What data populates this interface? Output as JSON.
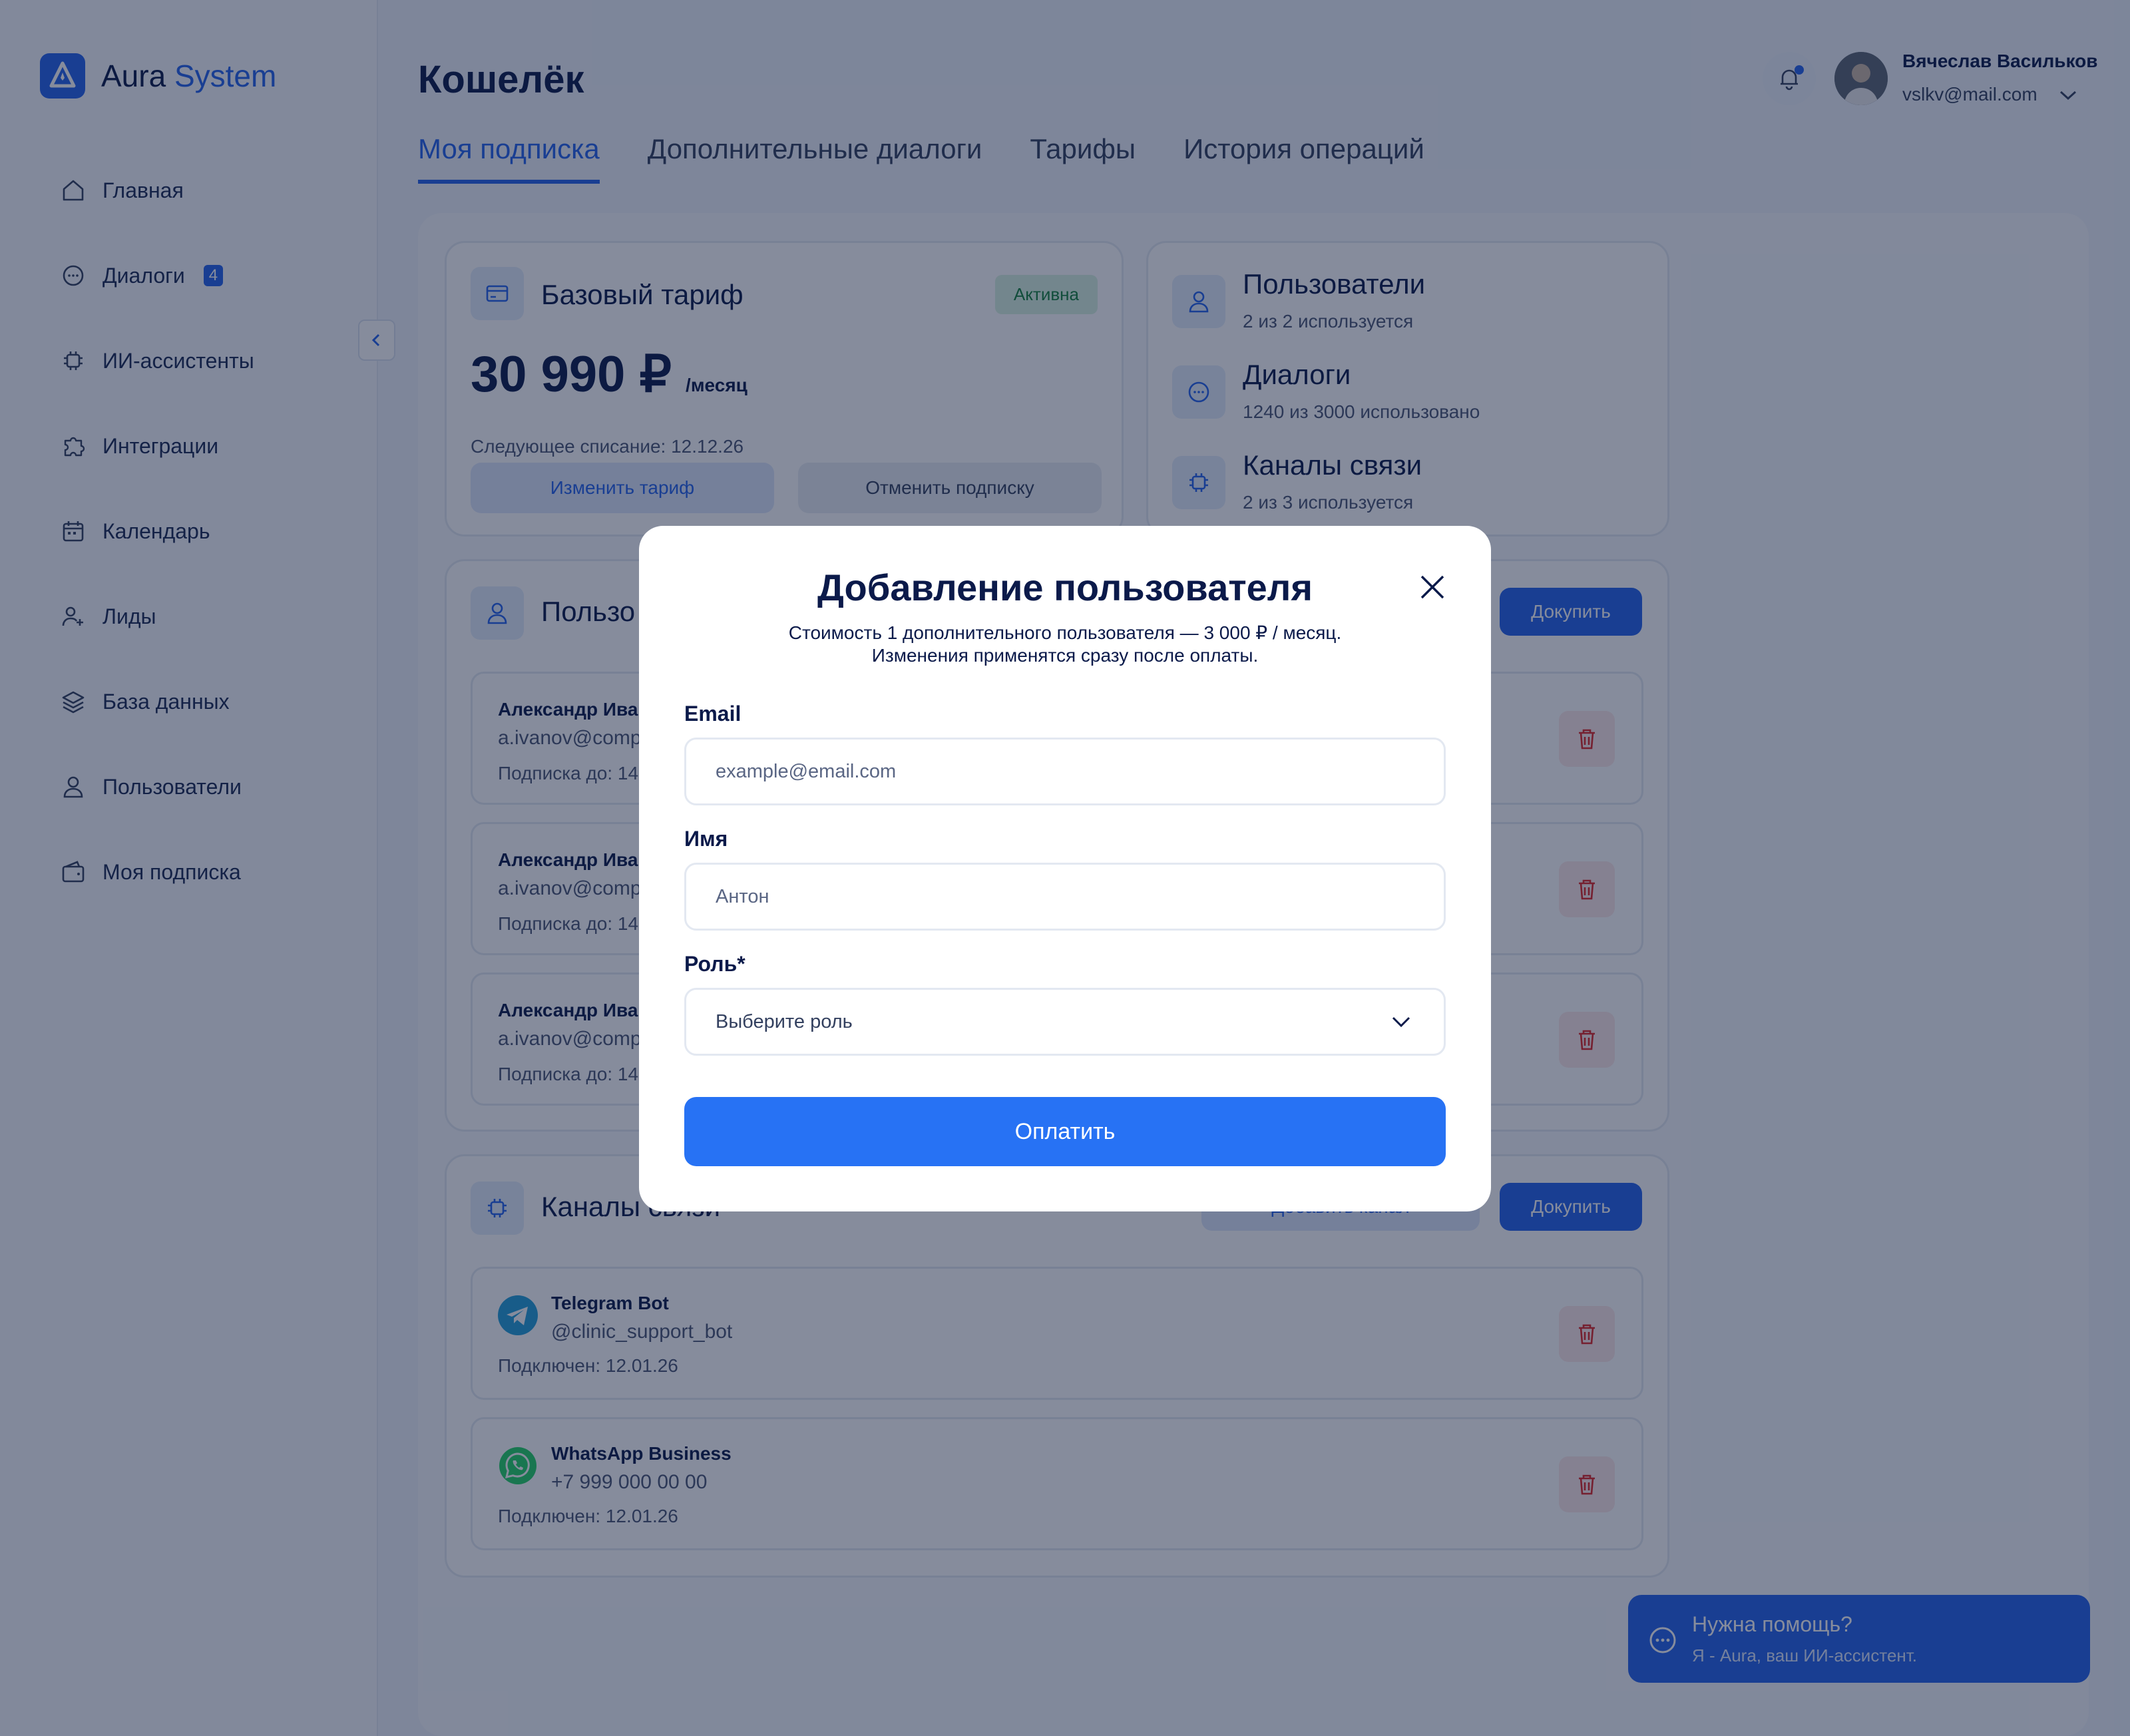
{
  "brand": {
    "name_part1": "Aura",
    "name_part2": "System"
  },
  "sidebar": {
    "items": [
      {
        "label": "Главная"
      },
      {
        "label": "Диалоги",
        "badge": "4"
      },
      {
        "label": "ИИ-ассистенты"
      },
      {
        "label": "Интеграции"
      },
      {
        "label": "Календарь"
      },
      {
        "label": "Лиды"
      },
      {
        "label": "База данных"
      },
      {
        "label": "Пользователи"
      },
      {
        "label": "Моя подписка"
      }
    ]
  },
  "header": {
    "title": "Кошелёк",
    "user_name": "Вячеслав Васильков",
    "user_email": "vslkv@mail.com"
  },
  "tabs": [
    {
      "label": "Моя подписка"
    },
    {
      "label": "Дополнительные диалоги"
    },
    {
      "label": "Тарифы"
    },
    {
      "label": "История операций"
    }
  ],
  "plan": {
    "title": "Базовый тариф",
    "status": "Активна",
    "price": "30 990 ₽",
    "period": "/месяц",
    "next_charge": "Следующее списание: 12.12.26",
    "change_label": "Изменить тариф",
    "cancel_label": "Отменить подписку"
  },
  "usage": [
    {
      "title": "Пользователи",
      "sub": "2 из 2 используется"
    },
    {
      "title": "Диалоги",
      "sub": "1240 из 3000 использовано"
    },
    {
      "title": "Каналы связи",
      "sub": "2 из 3 используется"
    }
  ],
  "users_card": {
    "title": "Пользо",
    "buy_label": "Докупить",
    "rows": [
      {
        "name": "Александр Ива",
        "email": "a.ivanov@compa",
        "sub": "Подписка до: 14"
      },
      {
        "name": "Александр Ива",
        "email": "a.ivanov@compa",
        "sub": "Подписка до: 14"
      },
      {
        "name": "Александр Ива",
        "email": "a.ivanov@compa",
        "sub": "Подписка до: 14"
      }
    ]
  },
  "channels_card": {
    "title": "Каналы связи",
    "add_label": "Добавить канал",
    "buy_label": "Докупить",
    "rows": [
      {
        "name": "Telegram Bot",
        "handle": "@clinic_support_bot",
        "connected": "Подключен: 12.01.26"
      },
      {
        "name": "WhatsApp Business",
        "handle": "+7 999 000 00 00",
        "connected": "Подключен: 12.01.26"
      }
    ]
  },
  "help": {
    "title": "Нужна помощь?",
    "sub": "Я - Aura, ваш ИИ-ассистент."
  },
  "modal": {
    "title": "Добавление пользователя",
    "sub_line1": "Стоимость 1 дополнительного пользователя — 3 000 ₽ / месяц.",
    "sub_line2": "Изменения применятся сразу после оплаты.",
    "email_label": "Email",
    "email_placeholder": "example@email.com",
    "name_label": "Имя",
    "name_placeholder": "Антон",
    "role_label": "Роль*",
    "role_placeholder": "Выберите роль",
    "pay_label": "Оплатить"
  },
  "colors": {
    "accent": "#2563eb",
    "overlay": "rgba(13,26,58,0.5)",
    "danger": "#dc2626",
    "success": "#15803d"
  }
}
